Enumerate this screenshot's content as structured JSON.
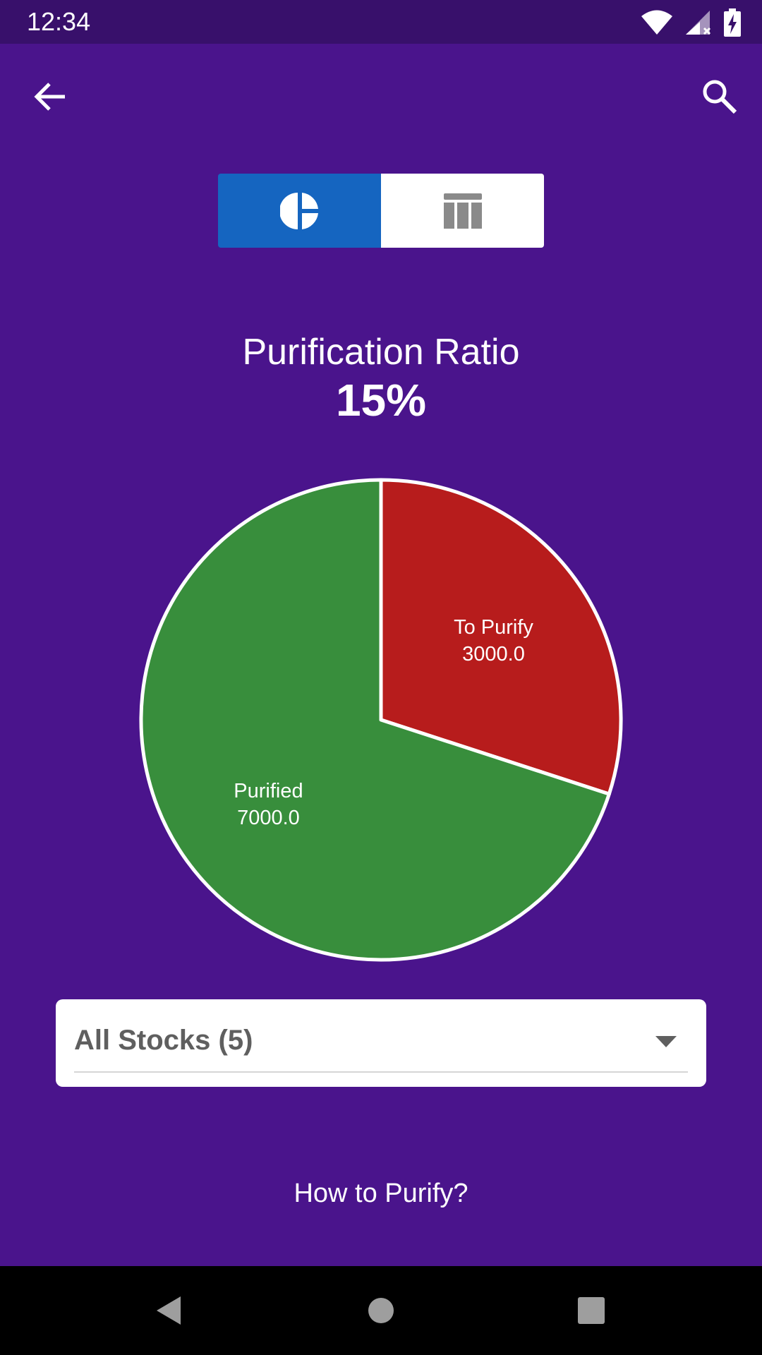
{
  "status_bar": {
    "time": "12:34",
    "icons": [
      "wifi-icon",
      "signal-icon",
      "battery-charging-icon"
    ]
  },
  "app_bar": {
    "back_icon": "arrow-back-icon",
    "search_icon": "search-icon"
  },
  "view_toggle": {
    "options": [
      {
        "icon": "pie-chart-icon",
        "selected": true
      },
      {
        "icon": "table-icon",
        "selected": false
      }
    ]
  },
  "summary": {
    "title": "Purification Ratio",
    "ratio": "15%"
  },
  "chart_data": {
    "type": "pie",
    "slices": [
      {
        "label": "To Purify",
        "value": 3000.0,
        "value_text": "3000.0",
        "color": "#b71c1c"
      },
      {
        "label": "Purified",
        "value": 7000.0,
        "value_text": "7000.0",
        "color": "#388e3c"
      }
    ]
  },
  "stock_filter": {
    "selected": "All Stocks (5)"
  },
  "footer_link": "How to Purify?",
  "colors": {
    "background": "#4a148c",
    "status_bar": "#38106b",
    "toggle_active": "#1565c0",
    "nav_bar": "#000000"
  },
  "nav_bar": {
    "icons": [
      "back-triangle-icon",
      "home-circle-icon",
      "recents-square-icon"
    ]
  }
}
